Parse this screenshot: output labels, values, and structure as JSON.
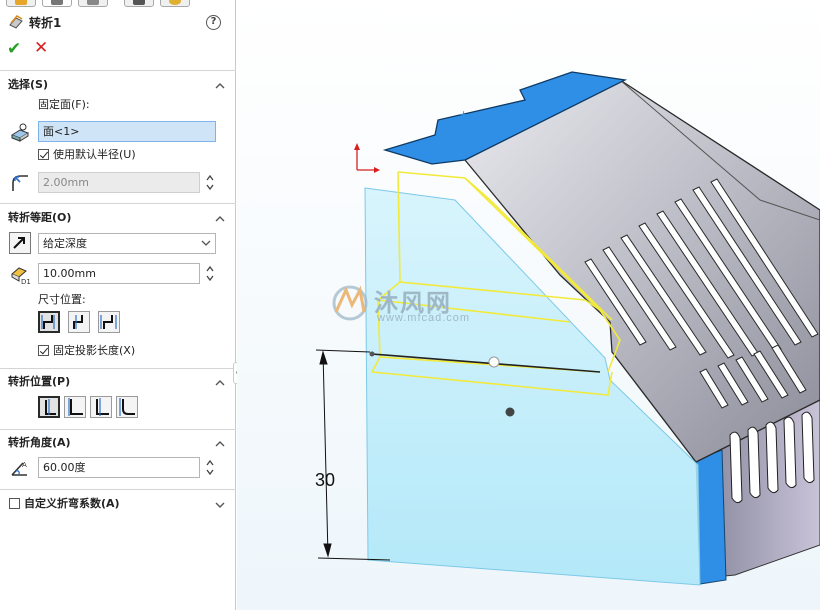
{
  "feature": {
    "title": "转折1",
    "ok_icon": "check-icon",
    "cancel_icon": "cross-icon",
    "help_icon": "help-icon",
    "help_label": "?"
  },
  "selection": {
    "header": "选择(S)",
    "fixed_face_label": "固定面(F):",
    "fixed_face_value": "面<1>",
    "use_default_radius_label": "使用默认半径(U)",
    "use_default_radius_checked": true,
    "radius_value": "2.00mm"
  },
  "offset": {
    "header": "转折等距(O)",
    "end_condition": "给定深度",
    "distance_value": "10.00mm",
    "dimension_position_label": "尺寸位置:",
    "fix_projected_length_label": "固定投影长度(X)",
    "fix_projected_length_checked": true
  },
  "position": {
    "header": "转折位置(P)"
  },
  "angle": {
    "header": "转折角度(A)",
    "value": "60.00度"
  },
  "custom_bend": {
    "label": "自定义折弯系数(A)",
    "checked": false
  },
  "viewport": {
    "dimension_text": "30",
    "watermark_brand": "沐风网",
    "watermark_url": "www.mfcad.com",
    "colors": {
      "accent_blue": "#2f8fe6",
      "ghost_cyan": "#bfeefb",
      "preview_yellow": "#f2ea3a"
    }
  }
}
